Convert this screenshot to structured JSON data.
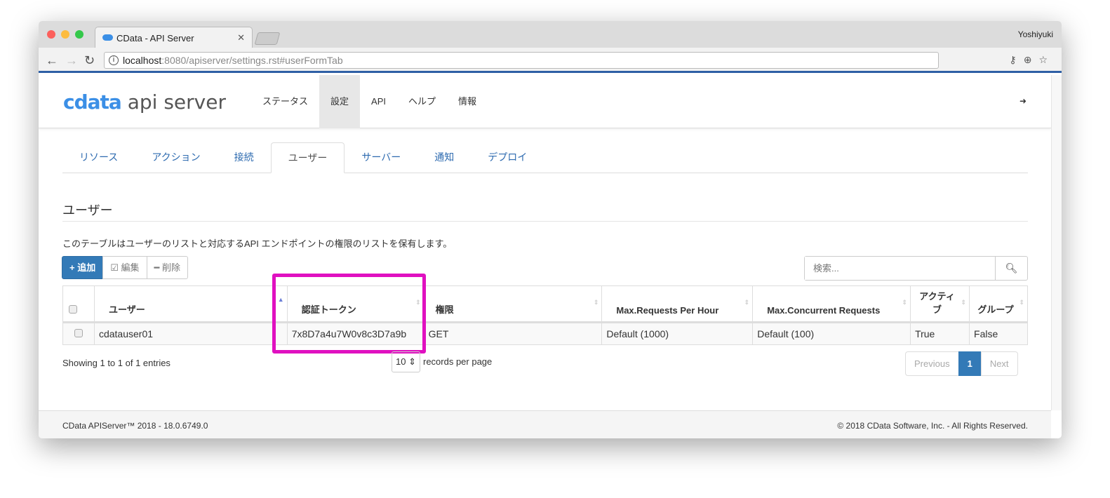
{
  "browser": {
    "tab_title": "CData - API Server",
    "user": "Yoshiyuki",
    "url_host": "localhost",
    "url_rest": ":8080/apiserver/settings.rst#userFormTab"
  },
  "header": {
    "logo_cdata": "cdata",
    "logo_rest": "api server",
    "menu": [
      "ステータス",
      "設定",
      "API",
      "ヘルプ",
      "情報"
    ]
  },
  "tabs": [
    "リソース",
    "アクション",
    "接続",
    "ユーザー",
    "サーバー",
    "通知",
    "デプロイ"
  ],
  "page": {
    "title": "ユーザー",
    "description": "このテーブルはユーザーのリストと対応するAPI エンドポイントの権限のリストを保有します。",
    "add": "+ 追加",
    "edit": "☑ 編集",
    "delete": "━ 削除",
    "search_placeholder": "検索..."
  },
  "table": {
    "columns": [
      "ユーザー",
      "認証トークン",
      "権限",
      "Max.Requests Per Hour",
      "Max.Concurrent Requests",
      "アクティブ",
      "グループ"
    ],
    "rows": [
      [
        "cdatauser01",
        "7x8D7a4u7W0v8c3D7a9b",
        "GET",
        "Default (1000)",
        "Default (100)",
        "True",
        "False"
      ]
    ]
  },
  "pagination": {
    "info": "Showing 1 to 1 of 1 entries",
    "page_size": "10",
    "page_size_label": "records per page",
    "previous": "Previous",
    "current": "1",
    "next": "Next"
  },
  "footer": {
    "left": "CData APIServer™ 2018 - 18.0.6749.0",
    "right": "© 2018 CData Software, Inc. - All Rights Reserved."
  }
}
